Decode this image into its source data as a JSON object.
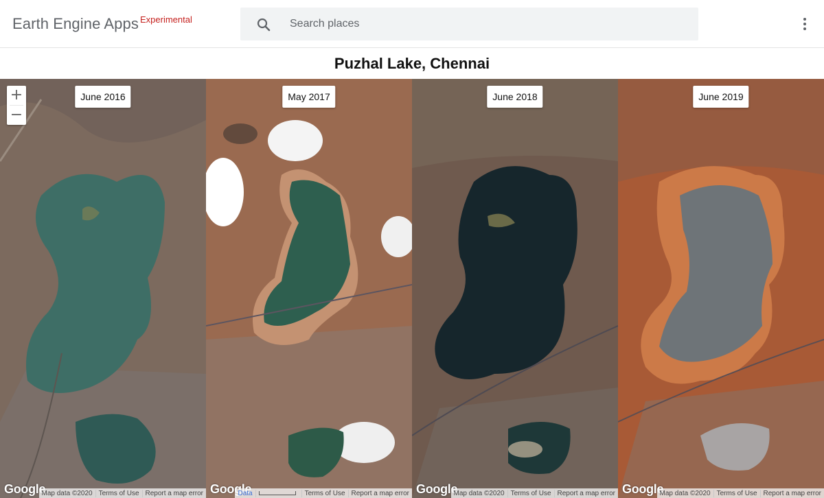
{
  "header": {
    "brand": "Earth Engine Apps",
    "brand_tag": "Experimental",
    "search_placeholder": "Search places"
  },
  "title": "Puzhal Lake, Chennai",
  "zoom": {
    "in": "+",
    "out": "−"
  },
  "panels": [
    {
      "date": "June 2016",
      "logo": "Google",
      "attribution": [
        "Map data ©2020",
        "Terms of Use",
        "Report a map error"
      ],
      "colors": {
        "land": "#7c6a5e",
        "lake": "#3e6e66",
        "soil": "#8e7565"
      }
    },
    {
      "date": "May 2017",
      "logo": "Google",
      "attribution": [
        "Data",
        "Terms of Use",
        "Report a map error"
      ],
      "colors": {
        "land": "#9a6a50",
        "lake": "#2e5f4f",
        "soil": "#b8855e"
      }
    },
    {
      "date": "June 2018",
      "logo": "Google",
      "attribution": [
        "Map data ©2020",
        "Terms of Use",
        "Report a map error"
      ],
      "colors": {
        "land": "#6f5a4e",
        "lake": "#16262c",
        "soil": "#8a6b55"
      }
    },
    {
      "date": "June 2019",
      "logo": "Google",
      "attribution": [
        "Map data ©2020",
        "Terms of Use",
        "Report a map error"
      ],
      "colors": {
        "land": "#a85a36",
        "lake": "#6e7478",
        "soil": "#cc7a48"
      }
    }
  ]
}
